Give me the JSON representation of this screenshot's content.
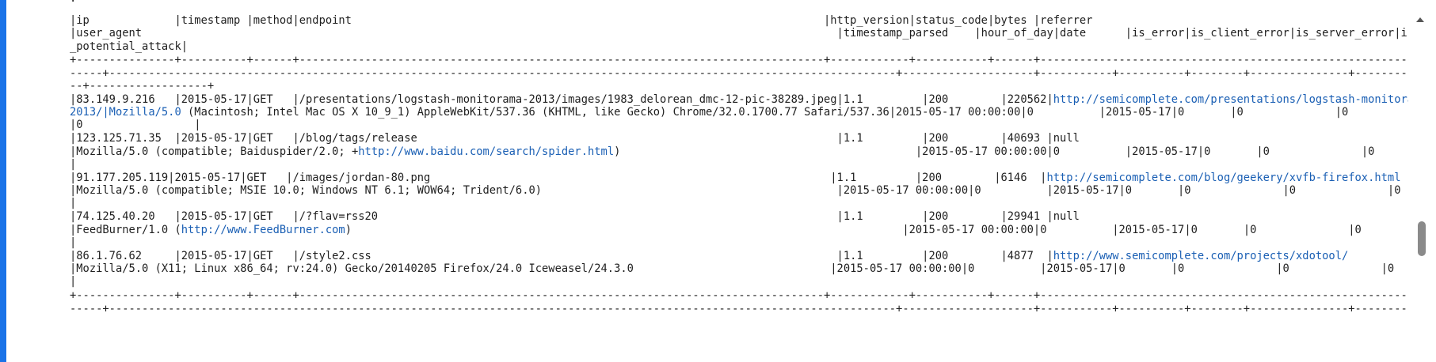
{
  "table_output": {
    "top_fragment": ".",
    "header_1": "|ip             |timestamp |method|endpoint                                                                        |http_version|status_code|bytes |referrer",
    "header_2": "|user_agent                                                                                                          |timestamp_parsed    |hour_of_day|date      |is_error|is_client_error|is_server_error|is",
    "header_3": "_potential_attack|",
    "separator": "+---------------+----------+------+--------------------------------------------------------------------------------+------------+-----------+------+------------------------------------------------------------------------------------------------",
    "separator_2": "-----+------------------------------------------------------------------------------------------------------------------------+--------------------+-----------+----------+--------+---------------+---------------+---",
    "separator_3": "--+------------------+",
    "rows": [
      {
        "line1_prefix": "|83.149.9.216   |2015-05-17|GET   |/presentations/logstash-monitorama-2013/images/1983_delorean_dmc-12-pic-38289.jpeg|1.1         |200        |220562|",
        "line1_link": "http://semicomplete.com/presentations/logstash-monitorama-",
        "line2_link": "2013/|Mozilla/5.0",
        "line2_rest": " (Macintosh; Intel Mac OS X 10_9_1) AppleWebKit/537.36 (KHTML, like Gecko) Chrome/32.0.1700.77 Safari/537.36|2015-05-17 00:00:00|0          |2015-05-17|0       |0              |0",
        "line3": "|0                 |"
      },
      {
        "line1_prefix": "|123.125.71.35  |2015-05-17|GET   |/blog/tags/release                                                                |1.1         |200        |40693 |null",
        "line2_pre": "|Mozilla/5.0 (compatible; Baiduspider/2.0; +",
        "line2_link": "http://www.baidu.com/search/spider.html",
        "line2_post": ")                                             |2015-05-17 00:00:00|0          |2015-05-17|0       |0              |0              |0",
        "line3": "|"
      },
      {
        "line1_prefix": "|91.177.205.119|2015-05-17|GET   |/images/jordan-80.png                                                             |1.1         |200        |6146  |",
        "line1_link": "http://semicomplete.com/blog/geekery/xvfb-firefox.html",
        "line2": "|Mozilla/5.0 (compatible; MSIE 10.0; Windows NT 6.1; WOW64; Trident/6.0)                                             |2015-05-17 00:00:00|0          |2015-05-17|0       |0              |0              |0",
        "line3": "|"
      },
      {
        "line1_prefix": "|74.125.40.20   |2015-05-17|GET   |/?flav=rss20                                                                      |1.1         |200        |29941 |null",
        "line2_pre": "|FeedBurner/1.0 (",
        "line2_link": "http://www.FeedBurner.com",
        "line2_post": ")                                                                                    |2015-05-17 00:00:00|0          |2015-05-17|0       |0              |0              |0",
        "line3": "|"
      },
      {
        "line1_prefix": "|86.1.76.62     |2015-05-17|GET   |/style2.css                                                                       |1.1         |200        |4877  |",
        "line1_link": "http://www.semicomplete.com/projects/xdotool/",
        "line2": "|Mozilla/5.0 (X11; Linux x86_64; rv:24.0) Gecko/20140205 Firefox/24.0 Iceweasel/24.3.0                              |2015-05-17 00:00:00|0          |2015-05-17|0       |0              |0              |0",
        "line3": "|"
      }
    ],
    "bottom_separator": "+---------------+----------+------+--------------------------------------------------------------------------------+------------+-----------+------+------------------------------------------------------------------------------------------------",
    "bottom_separator_2": "-----+------------------------------------------------------------------------------------------------------------------------+--------------------+-----------+----------+--------+---------------+---------------+---"
  }
}
